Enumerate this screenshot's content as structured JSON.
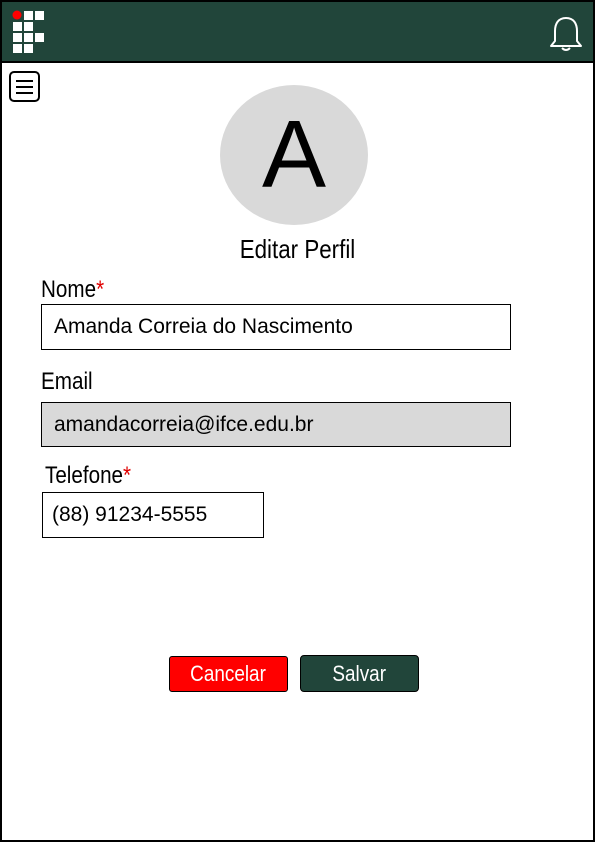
{
  "header": {
    "logo_icon": "institution-logo-icon",
    "notification_icon": "bell-icon",
    "color": "#21453a"
  },
  "menu": {
    "icon": "hamburger-menu-icon"
  },
  "profile": {
    "avatar_letter": "A",
    "title": "Editar Perfil"
  },
  "form": {
    "nome": {
      "label": "Nome",
      "required_mark": "*",
      "value": "Amanda Correia do Nascimento"
    },
    "email": {
      "label": "Email",
      "value": "amandacorreia@ifce.edu.br",
      "disabled": true
    },
    "telefone": {
      "label": "Telefone",
      "required_mark": "*",
      "value": "(88) 91234-5555"
    }
  },
  "actions": {
    "cancel_label": "Cancelar",
    "cancel_color": "#ff0000",
    "save_label": "Salvar",
    "save_color": "#21453a"
  }
}
